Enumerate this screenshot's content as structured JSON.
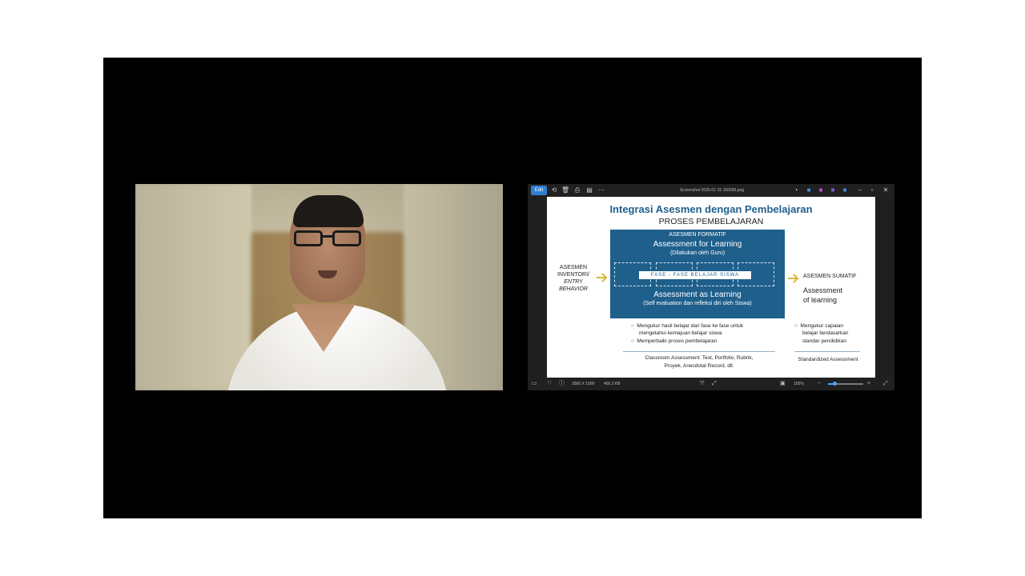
{
  "slide": {
    "title": "Integrasi Asesmen dengan Pembelajaran",
    "subtitle": "PROSES PEMBELAJARAN",
    "formatif_heading": "ASESMEN FORMATIF",
    "for_learning": "Assessment for Learning",
    "by_teacher": "(Dilakukan oleh Guru)",
    "phase_label": "FASE - FASE BELAJAR SISWA",
    "as_learning": "Assessment as Learning",
    "self_eval": "(Self evaluation dan refleksi diri oleh Siswa)",
    "left_label_1": "ASESMEN",
    "left_label_2": "INVENTORI/",
    "left_label_3": "ENTRY",
    "left_label_4": "BEHAVIOR",
    "sumatif_heading": "ASESMEN SUMATIF",
    "of_learning_1": "Assessment",
    "of_learning_2": "of learning",
    "bullets_formatif": [
      "Mengukur hasil belajar dari fase ke fase untuk",
      "mengetahui kemajuan belajar siswa",
      "Memperbaiki proses pembelajaran"
    ],
    "bullets_sumatif": [
      "Mengukur capaian",
      "belajar berdasarkan",
      "standar pendidikan"
    ],
    "classroom_1": "Classroom Assessment: Test, Portfolio, Rubrik,",
    "classroom_2": "Proyek, Anecdotal Record, dll.",
    "standardized": "Standardized Assessment"
  },
  "viewer": {
    "edit_label": "Edit",
    "filename": "Screenshot 2025-01-15 150000.png",
    "zoom_level": "105%",
    "zoom_fraction": 0.2,
    "dimensions_label": "3000 X 1000",
    "size_label": "400.2 KB"
  },
  "colors": {
    "slide_blue": "#1f5f8b",
    "arrow_gold": "#d8b83a",
    "accent": "#2f7fd1"
  }
}
